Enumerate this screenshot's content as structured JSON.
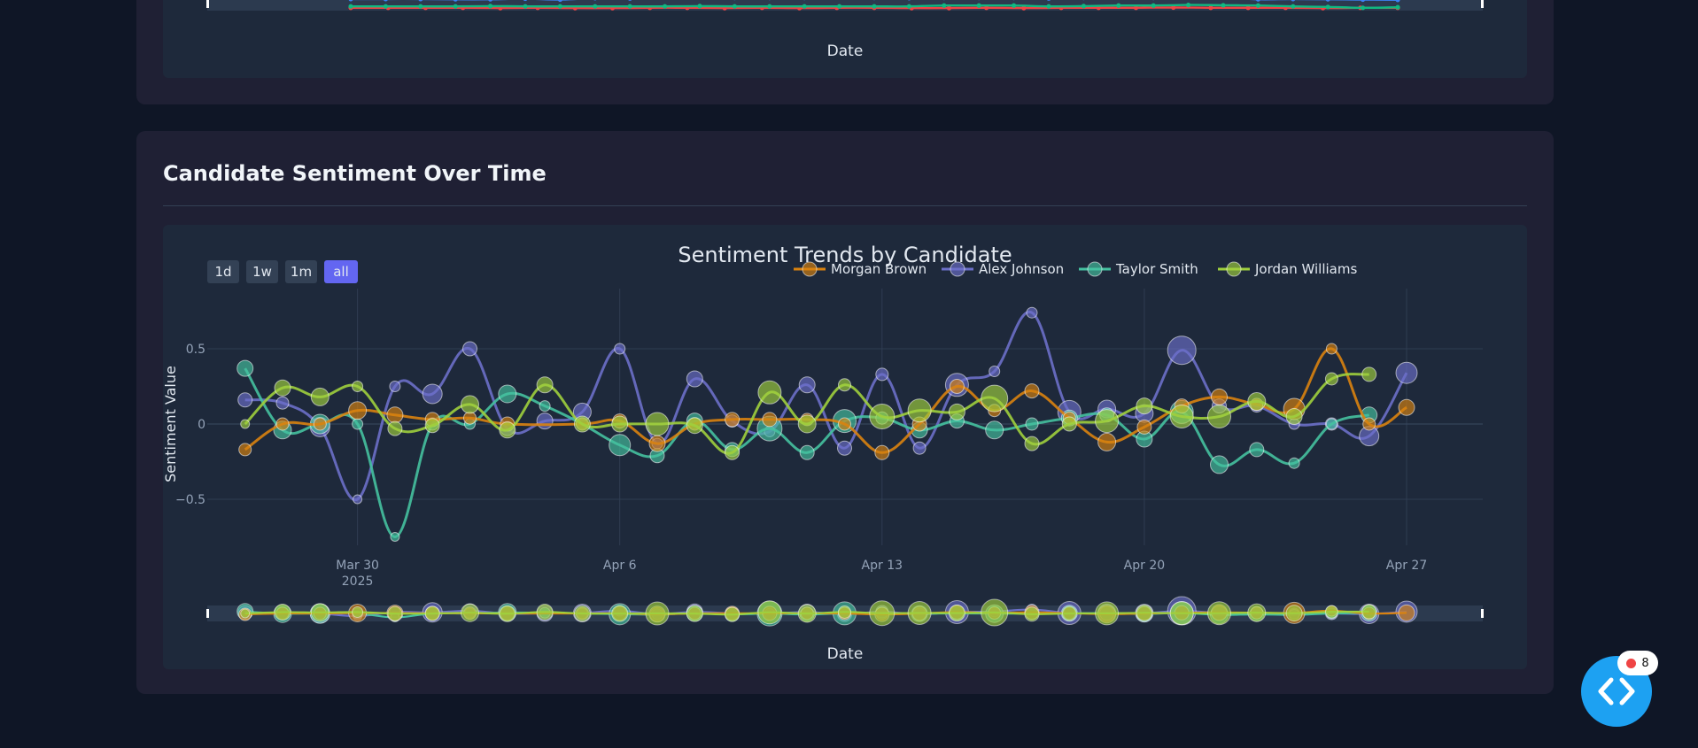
{
  "top_card": {
    "xaxis_title": "Date"
  },
  "section": {
    "title": "Candidate Sentiment Over Time"
  },
  "range_buttons": [
    {
      "label": "1d",
      "active": false
    },
    {
      "label": "1w",
      "active": false
    },
    {
      "label": "1m",
      "active": false
    },
    {
      "label": "all",
      "active": true
    }
  ],
  "fab": {
    "badge_count": "8"
  },
  "colors": {
    "morgan": "#d9820f",
    "alex": "#6b6fc9",
    "taylor": "#45c1a0",
    "jordan": "#9fcf3d",
    "active_button": "#6366f1",
    "top_blue": "#3b82f6",
    "top_red": "#ef4444",
    "top_green": "#10b981"
  },
  "top_mini_chart": {
    "series": [
      {
        "color_key": "top_blue",
        "values": [
          0.82,
          0.82,
          0.82,
          0.8,
          0.8,
          0.84,
          0.78,
          0.88,
          0.86,
          0.96,
          0.92,
          0.9,
          0.9,
          0.9,
          0.92,
          0.9,
          0.88,
          0.9,
          0.9,
          0.9,
          0.86,
          0.9,
          0.92,
          0.9,
          0.92,
          0.92,
          0.8,
          0.82,
          0.8,
          0.78,
          0.76
        ]
      },
      {
        "color_key": "top_red",
        "values": [
          0.2,
          0.2,
          0.2,
          0.2,
          0.18,
          0.2,
          0.18,
          0.18,
          0.2,
          0.2,
          0.18,
          0.2,
          0.18,
          0.2,
          0.2,
          0.18,
          0.18,
          0.2,
          0.18,
          0.2,
          0.2,
          0.2,
          0.22,
          0.2,
          0.2,
          0.2,
          0.18,
          0.2,
          0.2
        ]
      },
      {
        "color_key": "top_green",
        "values": [
          0.3,
          0.3,
          0.3,
          0.3,
          0.32,
          0.3,
          0.3,
          0.3,
          0.3,
          0.3,
          0.32,
          0.3,
          0.3,
          0.3,
          0.3,
          0.3,
          0.3,
          0.36,
          0.36,
          0.36,
          0.3,
          0.32,
          0.36,
          0.36,
          0.4,
          0.38,
          0.36,
          0.3,
          0.26,
          0.2,
          0.24
        ]
      }
    ]
  },
  "chart_data": {
    "type": "line",
    "title": "Sentiment Trends by Candidate",
    "xlabel": "Date",
    "ylabel": "Sentiment Value",
    "ylim": [
      -0.82,
      0.82
    ],
    "x_ticks": [
      {
        "label": "Mar 30",
        "sublabel": "2025",
        "day": 3
      },
      {
        "label": "Apr 6",
        "sublabel": "",
        "day": 10
      },
      {
        "label": "Apr 13",
        "sublabel": "",
        "day": 17
      },
      {
        "label": "Apr 20",
        "sublabel": "",
        "day": 24
      },
      {
        "label": "Apr 27",
        "sublabel": "",
        "day": 31
      }
    ],
    "y_ticks": [
      0.5,
      0,
      -0.5
    ],
    "y_tick_labels": [
      "0.5",
      "0",
      "−0.5"
    ],
    "legend_position": "top-right",
    "series": [
      {
        "name": "Morgan Brown",
        "color_key": "morgan",
        "points": [
          [
            0,
            -0.17,
            7
          ],
          [
            1,
            0,
            7
          ],
          [
            2,
            0,
            7
          ],
          [
            3,
            0.09,
            10
          ],
          [
            4,
            0.06,
            9
          ],
          [
            5,
            0.03,
            8
          ],
          [
            6,
            0.04,
            7
          ],
          [
            7,
            0,
            8
          ],
          [
            9,
            0,
            7
          ],
          [
            10,
            0.02,
            8
          ],
          [
            11,
            -0.13,
            9
          ],
          [
            12,
            0,
            7
          ],
          [
            13,
            0.03,
            8
          ],
          [
            14,
            0.03,
            8
          ],
          [
            15,
            0.03,
            7
          ],
          [
            16,
            0,
            7
          ],
          [
            17,
            -0.19,
            8
          ],
          [
            18,
            0,
            8
          ],
          [
            19,
            0.25,
            8
          ],
          [
            20,
            0.09,
            7
          ],
          [
            21,
            0.22,
            8
          ],
          [
            22,
            0.04,
            7
          ],
          [
            23,
            -0.12,
            10
          ],
          [
            24,
            -0.02,
            8
          ],
          [
            25,
            0.12,
            8
          ],
          [
            26,
            0.18,
            9
          ],
          [
            27,
            0.13,
            7
          ],
          [
            28,
            0.1,
            12
          ],
          [
            29,
            0.5,
            6
          ],
          [
            30,
            0,
            7
          ],
          [
            31,
            0.11,
            9
          ]
        ]
      },
      {
        "name": "Alex Johnson",
        "color_key": "alex",
        "points": [
          [
            0,
            0.16,
            8
          ],
          [
            1,
            0.14,
            7
          ],
          [
            2,
            -0.02,
            11
          ],
          [
            3,
            -0.5,
            5
          ],
          [
            4,
            0.25,
            6
          ],
          [
            5,
            0.2,
            11
          ],
          [
            6,
            0.5,
            8
          ],
          [
            7,
            -0.03,
            8
          ],
          [
            8,
            0.02,
            9
          ],
          [
            9,
            0.08,
            10
          ],
          [
            10,
            0.5,
            6
          ],
          [
            11,
            -0.13,
            6
          ],
          [
            12,
            0.3,
            9
          ],
          [
            13,
            0.02,
            7
          ],
          [
            14,
            -0.05,
            6
          ],
          [
            15,
            0.26,
            9
          ],
          [
            16,
            -0.16,
            8
          ],
          [
            17,
            0.33,
            7
          ],
          [
            18,
            -0.16,
            7
          ],
          [
            19,
            0.26,
            13
          ],
          [
            20,
            0.35,
            6
          ],
          [
            21,
            0.74,
            6
          ],
          [
            22,
            0.08,
            13
          ],
          [
            23,
            0.1,
            10
          ],
          [
            24,
            0.07,
            10
          ],
          [
            25,
            0.49,
            16
          ],
          [
            26,
            0.12,
            8
          ],
          [
            27,
            0.12,
            7
          ],
          [
            28,
            0,
            6
          ],
          [
            29,
            0,
            7
          ],
          [
            30,
            -0.08,
            11
          ],
          [
            31,
            0.34,
            12
          ]
        ]
      },
      {
        "name": "Taylor Smith",
        "color_key": "taylor",
        "points": [
          [
            0,
            0.37,
            9
          ],
          [
            1,
            -0.04,
            10
          ],
          [
            2,
            0,
            11
          ],
          [
            3,
            0,
            6
          ],
          [
            4,
            -0.75,
            5
          ],
          [
            5,
            0,
            7
          ],
          [
            6,
            0,
            6
          ],
          [
            7,
            0.2,
            10
          ],
          [
            8,
            0.12,
            6
          ],
          [
            9,
            0,
            6
          ],
          [
            10,
            -0.14,
            12
          ],
          [
            11,
            -0.21,
            8
          ],
          [
            12,
            0.02,
            9
          ],
          [
            13,
            -0.17,
            8
          ],
          [
            14,
            -0.03,
            14
          ],
          [
            15,
            -0.19,
            8
          ],
          [
            16,
            0.02,
            13
          ],
          [
            17,
            0.04,
            7
          ],
          [
            18,
            -0.04,
            9
          ],
          [
            19,
            0.02,
            8
          ],
          [
            20,
            -0.04,
            10
          ],
          [
            21,
            0,
            7
          ],
          [
            22,
            0.04,
            9
          ],
          [
            23,
            0.06,
            8
          ],
          [
            24,
            -0.1,
            9
          ],
          [
            25,
            0.08,
            13
          ],
          [
            26,
            -0.27,
            10
          ],
          [
            27,
            -0.17,
            8
          ],
          [
            28,
            -0.26,
            6
          ],
          [
            29,
            0,
            6
          ],
          [
            30,
            0.06,
            9
          ]
        ]
      },
      {
        "name": "Jordan Williams",
        "color_key": "jordan",
        "points": [
          [
            0,
            0,
            5
          ],
          [
            1,
            0.24,
            9
          ],
          [
            2,
            0.18,
            10
          ],
          [
            3,
            0.25,
            6
          ],
          [
            4,
            -0.03,
            8
          ],
          [
            5,
            -0.01,
            8
          ],
          [
            6,
            0.13,
            10
          ],
          [
            7,
            -0.04,
            9
          ],
          [
            8,
            0.26,
            9
          ],
          [
            9,
            0,
            9
          ],
          [
            10,
            0,
            9
          ],
          [
            11,
            0,
            13
          ],
          [
            12,
            -0.01,
            9
          ],
          [
            13,
            -0.19,
            8
          ],
          [
            14,
            0.21,
            13
          ],
          [
            15,
            0,
            10
          ],
          [
            16,
            0.26,
            7
          ],
          [
            17,
            0.05,
            14
          ],
          [
            18,
            0.09,
            13
          ],
          [
            19,
            0.08,
            9
          ],
          [
            20,
            0.17,
            15
          ],
          [
            21,
            -0.13,
            8
          ],
          [
            22,
            0,
            8
          ],
          [
            23,
            0.02,
            13
          ],
          [
            24,
            0.12,
            9
          ],
          [
            25,
            0.05,
            13
          ],
          [
            26,
            0.05,
            13
          ],
          [
            27,
            0.15,
            10
          ],
          [
            28,
            0.05,
            9
          ],
          [
            29,
            0.3,
            7
          ],
          [
            30,
            0.33,
            8
          ]
        ]
      }
    ]
  }
}
